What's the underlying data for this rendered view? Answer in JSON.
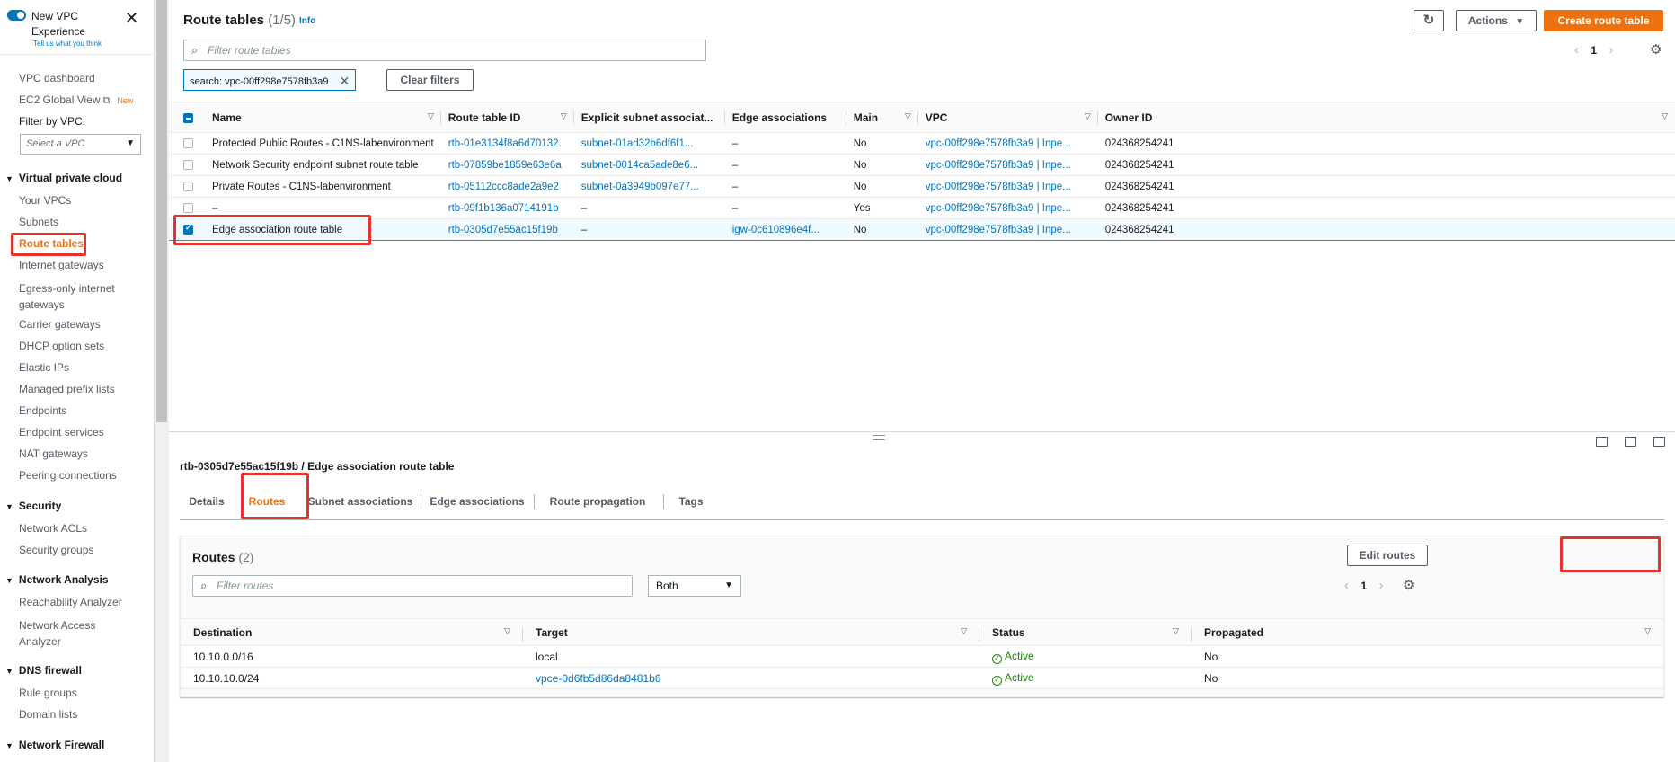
{
  "sidebar": {
    "title": "New VPC Experience",
    "feedback": "Tell us what you think",
    "close_icon": "close-icon",
    "top_items": [
      {
        "label": "VPC dashboard"
      },
      {
        "label": "EC2 Global View",
        "badge": "New"
      }
    ],
    "filter_label": "Filter by VPC:",
    "vpc_select_placeholder": "Select a VPC",
    "sections": {
      "vpc": "Virtual private cloud",
      "security": "Security",
      "network_analysis": "Network Analysis",
      "dns_firewall": "DNS firewall",
      "network_firewall": "Network Firewall"
    },
    "vpc_items": [
      "Your VPCs",
      "Subnets",
      "Route tables",
      "Internet gateways",
      "Egress-only internet gateways",
      "Carrier gateways",
      "DHCP option sets",
      "Elastic IPs",
      "Managed prefix lists",
      "Endpoints",
      "Endpoint services",
      "NAT gateways",
      "Peering connections"
    ],
    "security_items": [
      "Network ACLs",
      "Security groups"
    ],
    "analysis_items": [
      "Reachability Analyzer",
      "Network Access Analyzer"
    ],
    "dns_items": [
      "Rule groups",
      "Domain lists"
    ]
  },
  "header": {
    "title": "Route tables",
    "count": "(1/5)",
    "info": "Info",
    "actions_label": "Actions",
    "create_label": "Create route table",
    "search_placeholder": "Filter route tables",
    "token": "search: vpc-00ff298e7578fb3a9",
    "clear_filters": "Clear filters",
    "page": "1"
  },
  "route_tables": {
    "columns": [
      "Name",
      "Route table ID",
      "Explicit subnet associat...",
      "Edge associations",
      "Main",
      "VPC",
      "Owner ID"
    ],
    "rows": [
      {
        "name": "Protected Public Routes - C1NS-labenvironment",
        "id": "rtb-01e3134f8a6d70132",
        "subnet": "subnet-01ad32b6df6f1...",
        "edge": "–",
        "main": "No",
        "vpc": "vpc-00ff298e7578fb3a9 | Inpe...",
        "owner": "024368254241",
        "selected": false
      },
      {
        "name": "Network Security endpoint subnet route table",
        "id": "rtb-07859be1859e63e6a",
        "subnet": "subnet-0014ca5ade8e6...",
        "edge": "–",
        "main": "No",
        "vpc": "vpc-00ff298e7578fb3a9 | Inpe...",
        "owner": "024368254241",
        "selected": false
      },
      {
        "name": "Private Routes - C1NS-labenvironment",
        "id": "rtb-05112ccc8ade2a9e2",
        "subnet": "subnet-0a3949b097e77...",
        "edge": "–",
        "main": "No",
        "vpc": "vpc-00ff298e7578fb3a9 | Inpe...",
        "owner": "024368254241",
        "selected": false
      },
      {
        "name": "–",
        "id": "rtb-09f1b136a0714191b",
        "subnet": "–",
        "edge": "–",
        "main": "Yes",
        "vpc": "vpc-00ff298e7578fb3a9 | Inpe...",
        "owner": "024368254241",
        "selected": false
      },
      {
        "name": "Edge association route table",
        "id": "rtb-0305d7e55ac15f19b",
        "subnet": "–",
        "edge": "igw-0c610896e4f...",
        "main": "No",
        "vpc": "vpc-00ff298e7578fb3a9 | Inpe...",
        "owner": "024368254241",
        "selected": true
      }
    ]
  },
  "detail": {
    "title": "rtb-0305d7e55ac15f19b / Edge association route table",
    "tabs": [
      "Details",
      "Routes",
      "Subnet associations",
      "Edge associations",
      "Route propagation",
      "Tags"
    ],
    "active_tab": "Routes"
  },
  "routes": {
    "title": "Routes",
    "count": "(2)",
    "edit_label": "Edit routes",
    "filter_placeholder": "Filter routes",
    "select_value": "Both",
    "page": "1",
    "columns": [
      "Destination",
      "Target",
      "Status",
      "Propagated"
    ],
    "rows": [
      {
        "destination": "10.10.0.0/16",
        "target": "local",
        "status": "Active",
        "propagated": "No"
      },
      {
        "destination": "10.10.10.0/24",
        "target": "vpce-0d6fb5d86da8481b6",
        "status": "Active",
        "propagated": "No"
      }
    ]
  },
  "colors": {
    "accent": "#ec7211",
    "link": "#0073bb",
    "success": "#1d8102",
    "highlight": "#e8322e"
  }
}
